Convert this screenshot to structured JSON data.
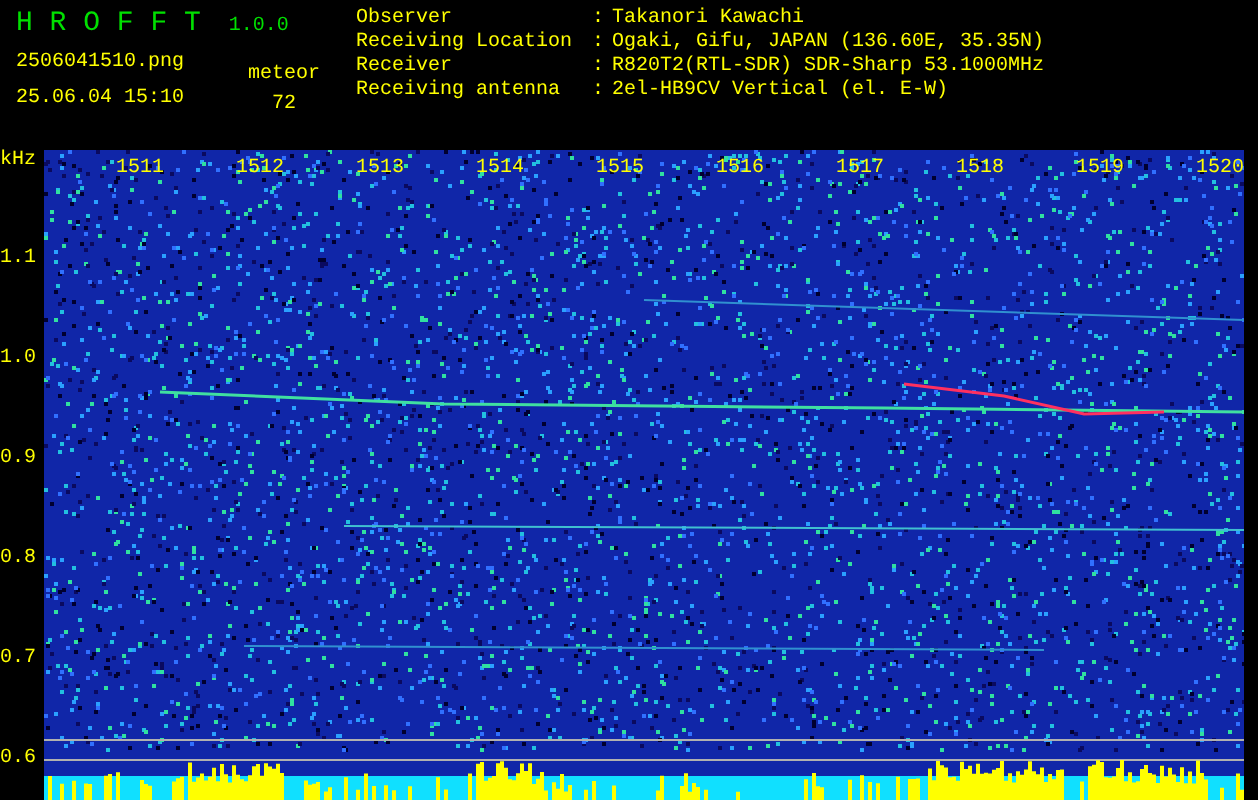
{
  "header": {
    "title": "H R O F F T",
    "version": "1.0.0",
    "filename": "2506041510.png",
    "datetime": "25.06.04 15:10",
    "mode_label": "meteor",
    "count": "72"
  },
  "station": [
    {
      "label": "Observer",
      "separator": ":",
      "value": "Takanori Kawachi"
    },
    {
      "label": "Receiving Location",
      "separator": ":",
      "value": "Ogaki, Gifu, JAPAN (136.60E, 35.35N)"
    },
    {
      "label": "Receiver",
      "separator": ":",
      "value": "R820T2(RTL-SDR) SDR-Sharp 53.1000MHz"
    },
    {
      "label": "Receiving antenna",
      "separator": ":",
      "value": "2el-HB9CV Vertical (el. E-W)"
    }
  ],
  "axis": {
    "unit": "kHz",
    "x_ticks": [
      "1511",
      "1512",
      "1513",
      "1514",
      "1515",
      "1516",
      "1517",
      "1518",
      "1519",
      "1520"
    ],
    "y_ticks": [
      "1.1",
      "1.0",
      "0.9",
      "0.8",
      "0.7",
      "0.6"
    ]
  }
}
